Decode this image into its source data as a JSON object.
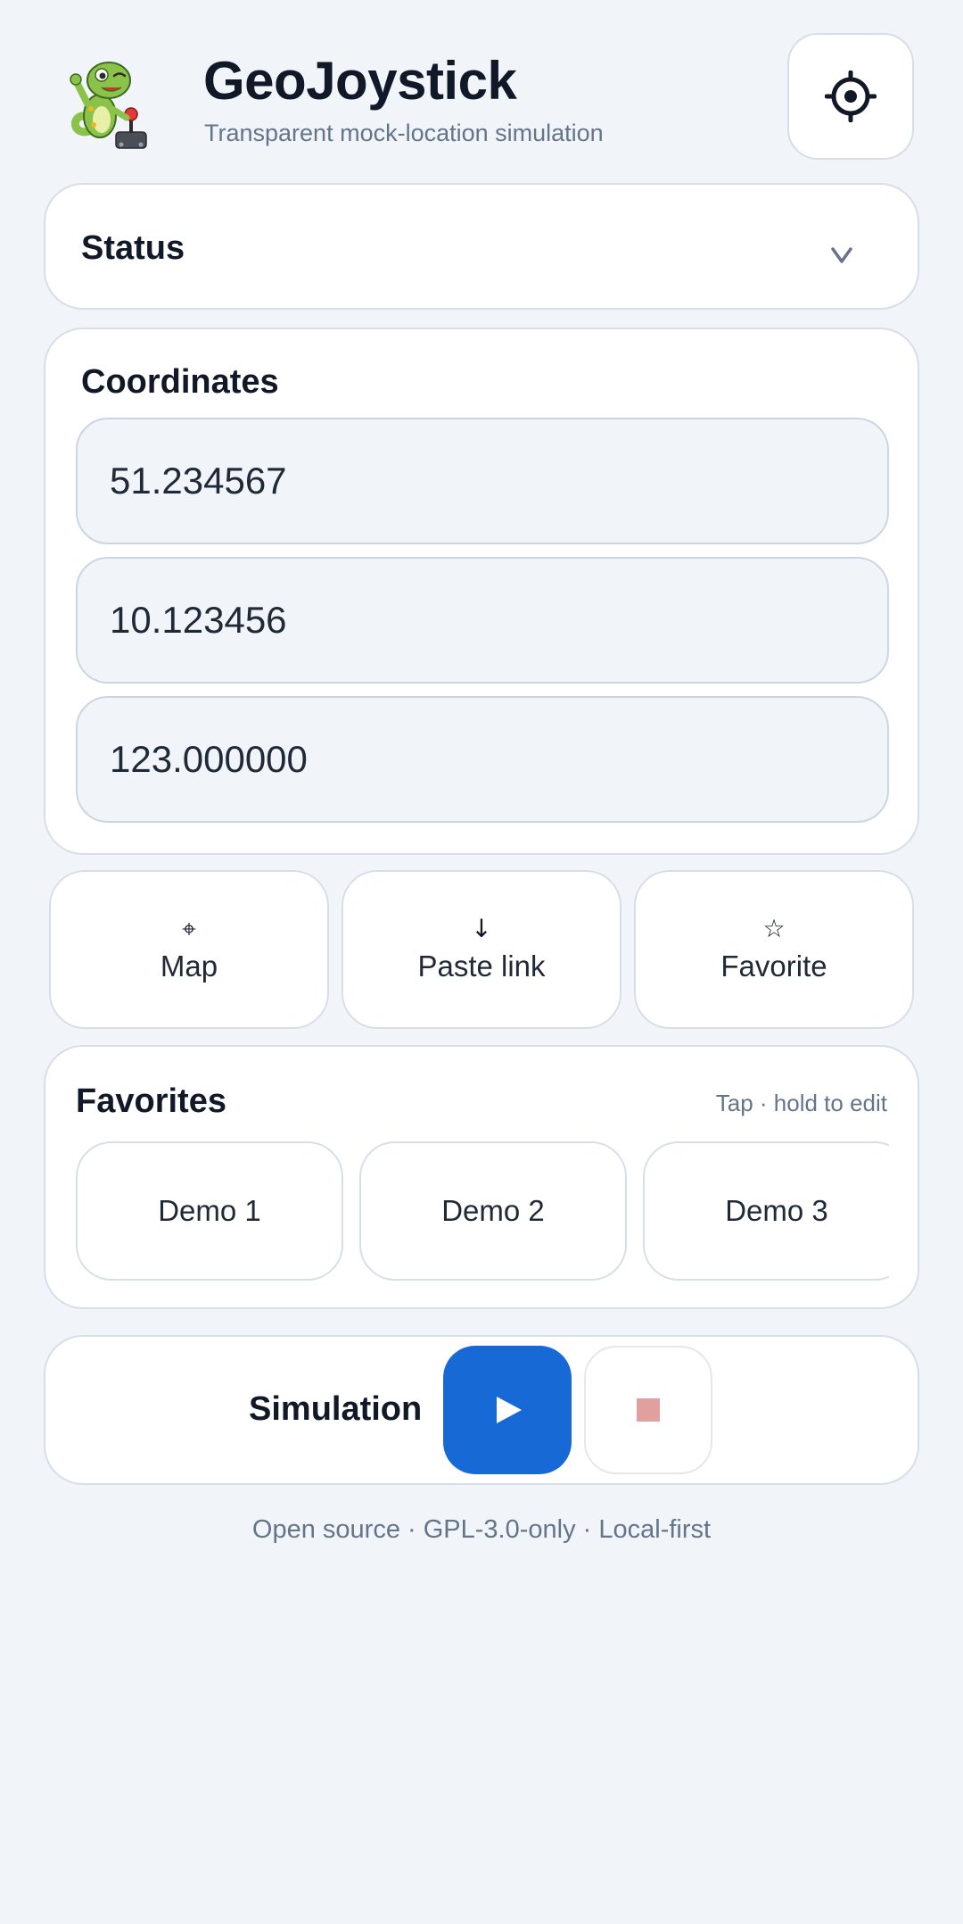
{
  "header": {
    "title": "GeoJoystick",
    "subtitle": "Transparent mock-location simulation",
    "logo_icon": "gecko-joystick-logo",
    "settings_icon": "settings-icon"
  },
  "status": {
    "title": "Status",
    "expand_icon": "chevron-down-icon",
    "expand_glyph": "v"
  },
  "coordinates": {
    "title": "Coordinates",
    "latitude": "51.234567",
    "longitude": "10.123456",
    "altitude": "123.000000"
  },
  "actions": [
    {
      "icon": "crosshair-icon",
      "glyph": "⌖",
      "label": "Map"
    },
    {
      "icon": "arrow-down-icon",
      "glyph": "↓",
      "label": "Paste link"
    },
    {
      "icon": "star-icon",
      "glyph": "☆",
      "label": "Favorite"
    }
  ],
  "favorites": {
    "title": "Favorites",
    "hint": "Tap · hold to edit",
    "items": [
      "Demo 1",
      "Demo 2",
      "Demo 3"
    ]
  },
  "simulation": {
    "title": "Simulation",
    "play_glyph": "▶",
    "play_icon": "play-icon",
    "stop_icon": "stop-icon"
  },
  "colors": {
    "accent": "#1769d6",
    "background": "#f1f5f9",
    "stop_disabled": "#e0a09e"
  },
  "footer": "Open source · GPL-3.0-only · Local-first"
}
